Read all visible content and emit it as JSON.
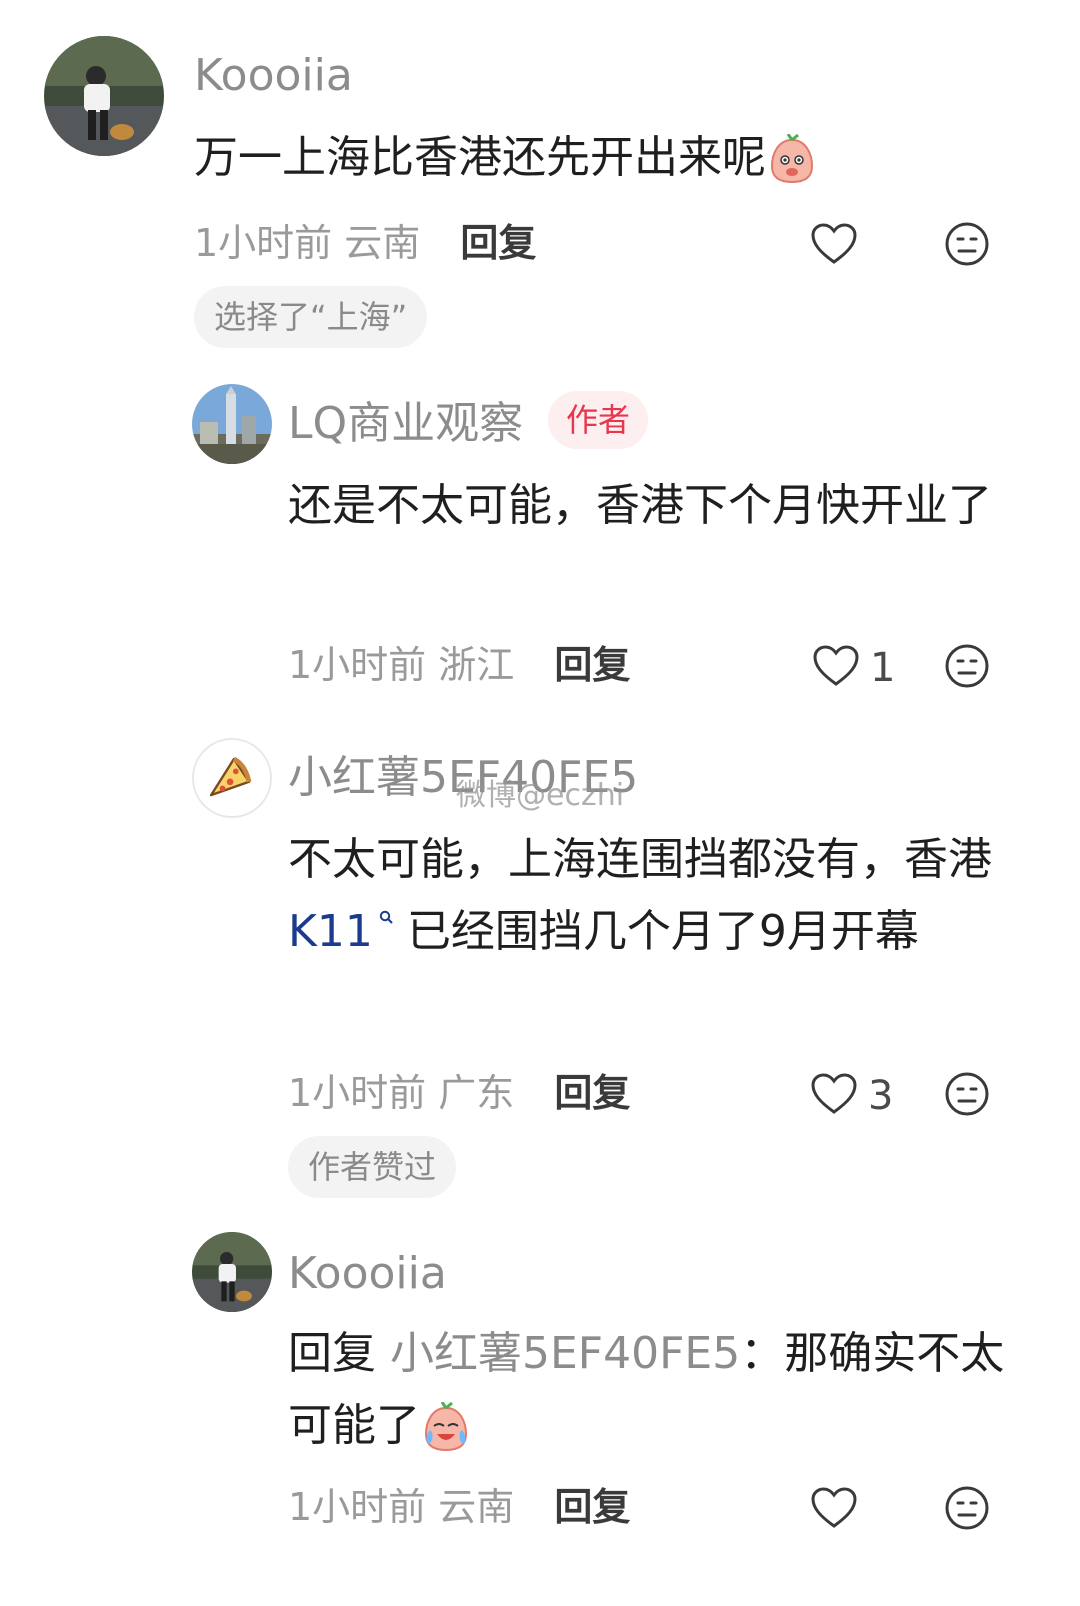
{
  "comments": [
    {
      "username": "Koooiia",
      "text": "万一上海比香港还先开出来呢",
      "time": "1小时前",
      "location": "云南",
      "reply_label": "回复",
      "tag": "选择了“上海”"
    },
    {
      "username": "LQ商业观察",
      "badge": "作者",
      "text": "还是不太可能，香港下个月快开业了",
      "time": "1小时前",
      "location": "浙江",
      "reply_label": "回复",
      "likes": "1"
    },
    {
      "username": "小红薯5EF40FE5",
      "text_a": "不太可能，上海连围挡都没有，香港 ",
      "link": "K11",
      "text_b": " 已经围挡几个月了9月开幕",
      "time": "1小时前",
      "location": "广东",
      "reply_label": "回复",
      "likes": "3",
      "tag": "作者赞过"
    },
    {
      "username": "Koooiia",
      "reply_prefix": "回复 ",
      "mention": "小红薯5EF40FE5",
      "text": "：那确实不太可能了",
      "time": "1小时前",
      "location": "云南",
      "reply_label": "回复"
    }
  ],
  "watermark": "微博@eczhi"
}
